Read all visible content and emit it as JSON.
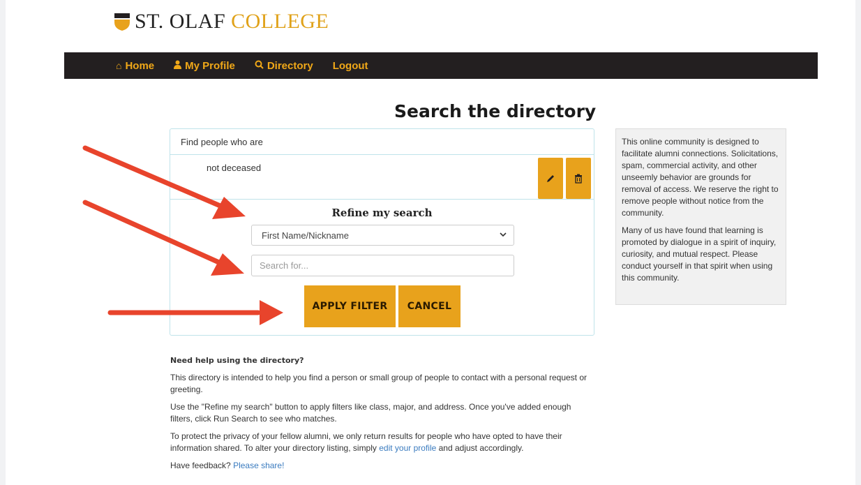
{
  "logo": {
    "prefix": "ST. OLAF",
    "suffix": "COLLEGE"
  },
  "nav": {
    "items": [
      {
        "icon": "home-icon",
        "label": "Home"
      },
      {
        "icon": "user-icon",
        "label": "My Profile"
      },
      {
        "icon": "search-icon",
        "label": "Directory"
      },
      {
        "icon": "",
        "label": "Logout"
      }
    ]
  },
  "page": {
    "title": "Search the directory"
  },
  "search_card": {
    "header": "Find people who are",
    "criteria": "not deceased",
    "refine_title": "Refine my search",
    "field_select": "First Name/Nickname",
    "search_placeholder": "Search for...",
    "apply_label": "APPLY FILTER",
    "cancel_label": "CANCEL"
  },
  "note": {
    "p1": "This online community is designed to facilitate alumni connections. Solicitations, spam, commercial activity, and other unseemly behavior are grounds for removal of access. We reserve the right to remove people without notice from the community.",
    "p2": "Many of us have found that learning is promoted by dialogue in a spirit of inquiry, curiosity, and mutual respect. Please conduct yourself in that spirit when using this community."
  },
  "help": {
    "heading": "Need help using the directory?",
    "p1": "This directory is intended to help you find a person or small group of people to contact with a personal request or greeting.",
    "p2": "Use the \"Refine my search\" button to apply filters like class, major, and address. Once you've added enough filters, click Run Search to see who matches.",
    "p3_before": "To protect the privacy of your fellow alumni, we only return results for people who have opted to have their information shared. To alter your directory listing, simply ",
    "p3_link": "edit your profile",
    "p3_after": " and adjust accordingly.",
    "p4_before": "Have feedback? ",
    "p4_link": "Please share!"
  },
  "colors": {
    "brand_gold": "#e8a21c",
    "nav_bg": "#231f20",
    "arrow": "#e8442c",
    "link": "#3a7bbf"
  }
}
